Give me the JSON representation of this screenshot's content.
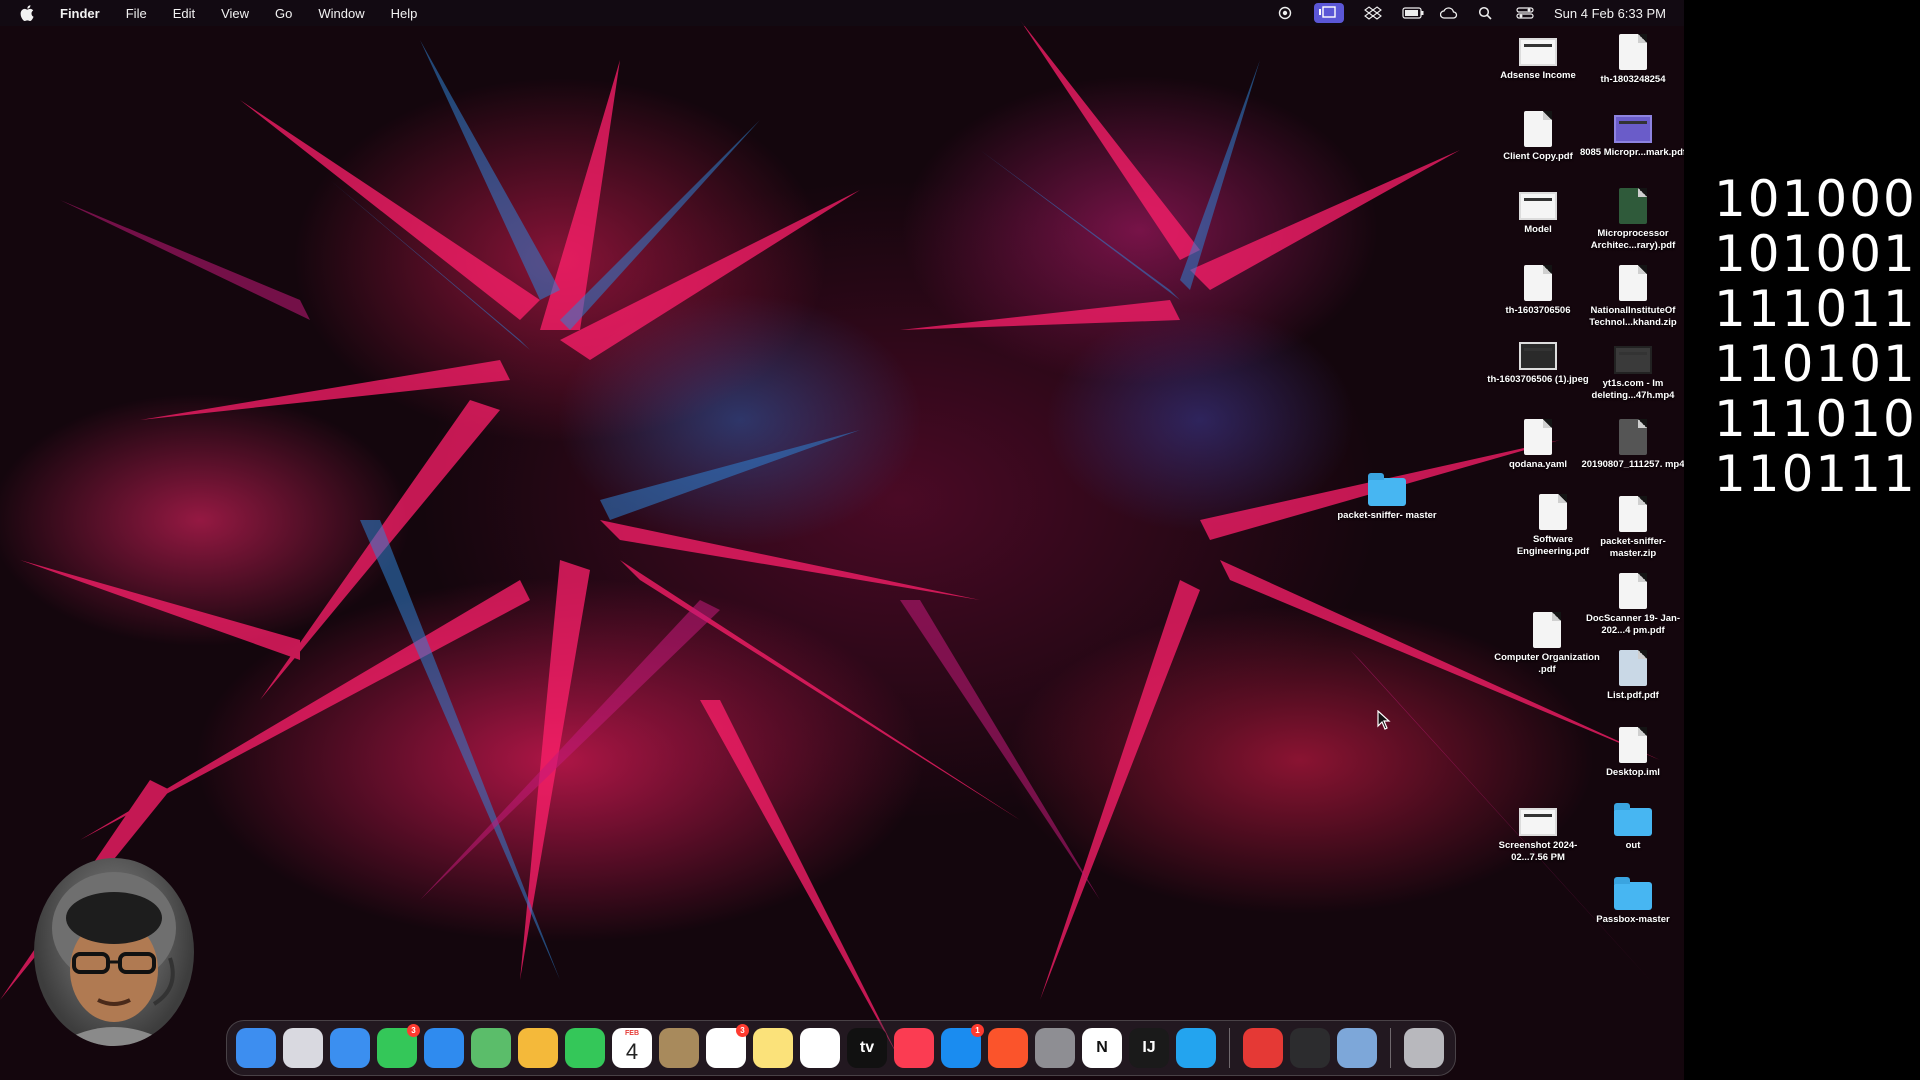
{
  "menubar": {
    "apple_icon": "apple-logo-icon",
    "app_name": "Finder",
    "menus": [
      "File",
      "Edit",
      "View",
      "Go",
      "Window",
      "Help"
    ],
    "status_icons": [
      "screen-record-icon",
      "stage-manager-icon",
      "dropbox-icon",
      "battery-icon",
      "cloud-icon",
      "search-icon",
      "control-center-icon"
    ],
    "clock": "Sun 4 Feb  6:33 PM"
  },
  "desktop": {
    "icons": [
      {
        "label": "Adsense Income",
        "kind": "screenshot"
      },
      {
        "label": "th-1803248254",
        "kind": "document"
      },
      {
        "label": "Client Copy.pdf",
        "kind": "document"
      },
      {
        "label": "8085 Micropr...mark.pdf",
        "kind": "document"
      },
      {
        "label": "Model",
        "kind": "screenshot"
      },
      {
        "label": "Microprocessor Architec...rary).pdf",
        "kind": "document"
      },
      {
        "label": "th-1603706506",
        "kind": "document"
      },
      {
        "label": "NationalInstituteOf Technol...khand.zip",
        "kind": "archive"
      },
      {
        "label": "th-1603706506 (1).jpeg",
        "kind": "image"
      },
      {
        "label": "yt1s.com - Im deleting...47h.mp4",
        "kind": "video"
      },
      {
        "label": "qodana.yaml",
        "kind": "document"
      },
      {
        "label": "20190807_111257. mp4",
        "kind": "video"
      },
      {
        "label": "packet-sniffer- master",
        "kind": "folder"
      },
      {
        "label": "Software Engineering.pdf",
        "kind": "document"
      },
      {
        "label": "packet-sniffer- master.zip",
        "kind": "archive"
      },
      {
        "label": "DocScanner 19- Jan-202...4 pm.pdf",
        "kind": "document"
      },
      {
        "label": "Computer Organization .pdf",
        "kind": "document"
      },
      {
        "label": "List.pdf.pdf",
        "kind": "document"
      },
      {
        "label": "Desktop.iml",
        "kind": "document"
      },
      {
        "label": "Screenshot 2024-02...7.56 PM",
        "kind": "screenshot"
      },
      {
        "label": "out",
        "kind": "folder"
      },
      {
        "label": "Passbox-master",
        "kind": "folder"
      }
    ]
  },
  "dock": {
    "apps": [
      {
        "name": "Finder",
        "icon": "finder-icon",
        "color": "#3d8ef0"
      },
      {
        "name": "Launchpad",
        "icon": "launchpad-icon",
        "color": "#d9d9e0"
      },
      {
        "name": "Safari",
        "icon": "safari-icon",
        "color": "#3b8ff0"
      },
      {
        "name": "Messages",
        "icon": "messages-icon",
        "color": "#34c759",
        "badge": "3"
      },
      {
        "name": "Mail",
        "icon": "mail-icon",
        "color": "#2f8bef"
      },
      {
        "name": "Maps",
        "icon": "maps-icon",
        "color": "#5bbd6a"
      },
      {
        "name": "Photos",
        "icon": "photos-icon",
        "color": "#f4b93a"
      },
      {
        "name": "FaceTime",
        "icon": "facetime-icon",
        "color": "#34c759"
      },
      {
        "name": "Calendar",
        "icon": "calendar-icon",
        "color": "#ffffff",
        "month": "FEB",
        "day": "4"
      },
      {
        "name": "Contacts",
        "icon": "contacts-icon",
        "color": "#a88a5c"
      },
      {
        "name": "Reminders",
        "icon": "reminders-icon",
        "color": "#ffffff",
        "badge": "3"
      },
      {
        "name": "Notes",
        "icon": "notes-icon",
        "color": "#fbe27a"
      },
      {
        "name": "Freeform",
        "icon": "freeform-icon",
        "color": "#ffffff"
      },
      {
        "name": "Apple TV",
        "icon": "apple-tv-icon",
        "color": "#111111",
        "text": "tv"
      },
      {
        "name": "Music",
        "icon": "music-icon",
        "color": "#fb3c52"
      },
      {
        "name": "App Store",
        "icon": "app-store-icon",
        "color": "#1a8cf0",
        "badge": "1"
      },
      {
        "name": "Brave",
        "icon": "brave-icon",
        "color": "#fb542b"
      },
      {
        "name": "System Settings",
        "icon": "settings-gear-icon",
        "color": "#8e8e93"
      },
      {
        "name": "Notion",
        "icon": "notion-icon",
        "color": "#ffffff",
        "text": "N"
      },
      {
        "name": "IntelliJ IDEA",
        "icon": "intellij-icon",
        "color": "#1a1a1a",
        "text": "IJ"
      },
      {
        "name": "Visual Studio Code",
        "icon": "vscode-icon",
        "color": "#23a4ef"
      }
    ],
    "recent_apps": [
      {
        "name": "PDF Expert",
        "icon": "pdf-icon",
        "color": "#e53935"
      },
      {
        "name": "Activity Monitor",
        "icon": "activity-monitor-icon",
        "color": "#2c2c2e"
      },
      {
        "name": "Preview",
        "icon": "preview-icon",
        "color": "#7da7d9"
      }
    ],
    "trash": {
      "name": "Trash",
      "icon": "trash-icon",
      "color": "#b8b8bd"
    }
  },
  "binary_panel": {
    "lines": [
      "101000",
      "101001",
      "111011",
      "110101",
      "111010",
      "110111"
    ]
  }
}
